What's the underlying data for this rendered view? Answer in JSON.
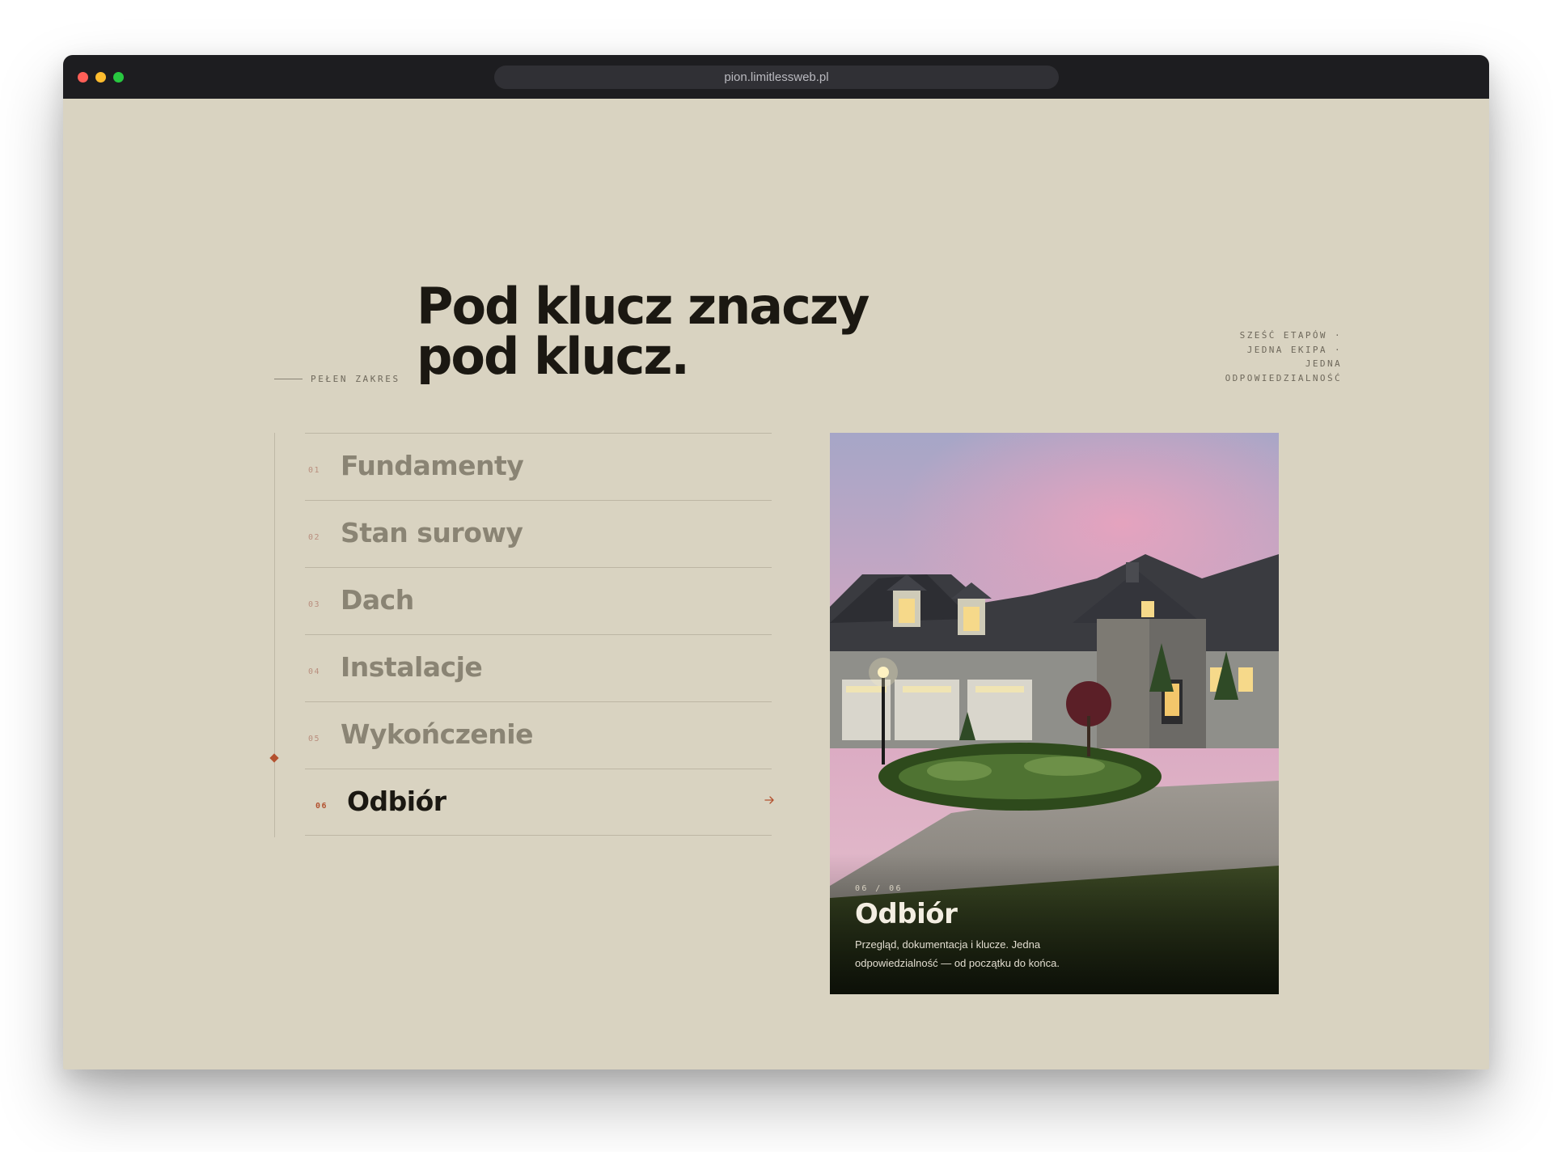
{
  "browser": {
    "url": "pion.limitlessweb.pl"
  },
  "hero": {
    "eyebrow": "PEŁEN ZAKRES",
    "heading_line1": "Pod klucz znaczy",
    "heading_line2": "pod klucz.",
    "tagline_line1": "SZEŚĆ ETAPÓW ·",
    "tagline_line2": "JEDNA EKIPA ·",
    "tagline_line3": "JEDNA",
    "tagline_line4": "ODPOWIEDZIALNOŚĆ"
  },
  "steps": [
    {
      "num": "01",
      "label": "Fundamenty"
    },
    {
      "num": "02",
      "label": "Stan surowy"
    },
    {
      "num": "03",
      "label": "Dach"
    },
    {
      "num": "04",
      "label": "Instalacje"
    },
    {
      "num": "05",
      "label": "Wykończenie"
    },
    {
      "num": "06",
      "label": "Odbiór"
    }
  ],
  "active_step": 6,
  "card": {
    "counter": "06 / 06",
    "title": "Odbiór",
    "description": "Przegląd, dokumentacja i klucze. Jedna odpowiedzialność — od początku do końca."
  },
  "icons": {
    "step_arrow": "arrow-right-icon",
    "rail_marker": "diamond-marker-icon"
  },
  "colors": {
    "background": "#d9d3c1",
    "ink": "#1b1812",
    "muted": "#8a8474",
    "accent": "#b3512f",
    "titlebar": "#1d1d20"
  }
}
